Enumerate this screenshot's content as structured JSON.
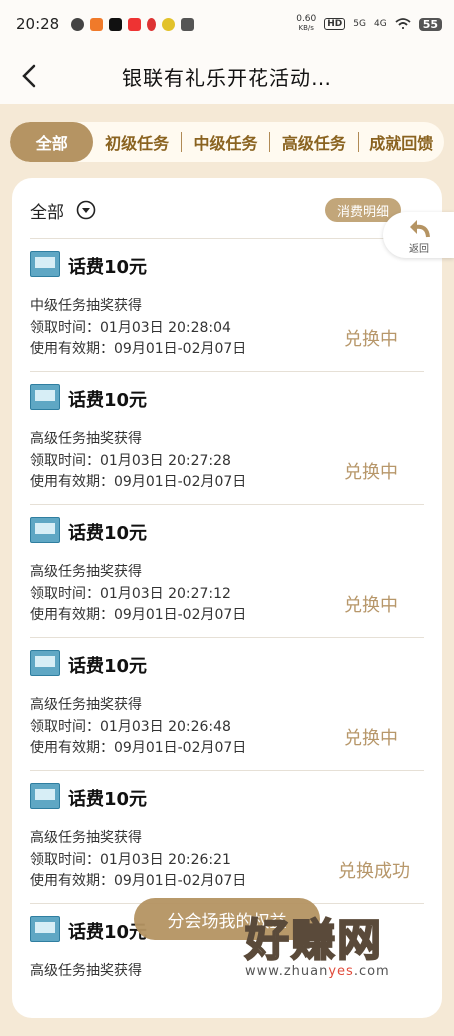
{
  "status_bar": {
    "time": "20:28",
    "network_speed": "0.60",
    "network_unit": "KB/s",
    "hd": "HD",
    "sig1": "5G",
    "sig2": "4G",
    "battery": "55"
  },
  "header": {
    "title": "银联有礼乐开花活动…"
  },
  "tabs": [
    {
      "label": "全部",
      "active": true
    },
    {
      "label": "初级任务"
    },
    {
      "label": "中级任务"
    },
    {
      "label": "高级任务"
    },
    {
      "label": "成就回馈"
    }
  ],
  "filter": {
    "label": "全部",
    "detail_label": "消费明细"
  },
  "float_return": {
    "label": "返回"
  },
  "items": [
    {
      "title": "话费10元",
      "source": "中级任务抽奖获得",
      "time": "领取时间：01月03日 20:28:04",
      "valid": "使用有效期：09月01日-02月07日",
      "status": "兑换中"
    },
    {
      "title": "话费10元",
      "source": "高级任务抽奖获得",
      "time": "领取时间：01月03日 20:27:28",
      "valid": "使用有效期：09月01日-02月07日",
      "status": "兑换中"
    },
    {
      "title": "话费10元",
      "source": "高级任务抽奖获得",
      "time": "领取时间：01月03日 20:27:12",
      "valid": "使用有效期：09月01日-02月07日",
      "status": "兑换中"
    },
    {
      "title": "话费10元",
      "source": "高级任务抽奖获得",
      "time": "领取时间：01月03日 20:26:48",
      "valid": "使用有效期：09月01日-02月07日",
      "status": "兑换中"
    },
    {
      "title": "话费10元",
      "source": "高级任务抽奖获得",
      "time": "领取时间：01月03日 20:26:21",
      "valid": "使用有效期：09月01日-02月07日",
      "status": "兑换成功"
    },
    {
      "title": "话费10元",
      "source": "高级任务抽奖获得",
      "time": "",
      "valid": "",
      "status": ""
    }
  ],
  "bottom_button": {
    "label": "分会场我的权益"
  },
  "watermark": {
    "main": "好赚网",
    "url_prefix": "www.zhuan",
    "url_highlight": "yes",
    "url_suffix": ".com"
  },
  "colors": {
    "accent": "#b59463",
    "status": "#b7976a",
    "tab_text": "#8a6320",
    "background": "#f5e9d6"
  }
}
